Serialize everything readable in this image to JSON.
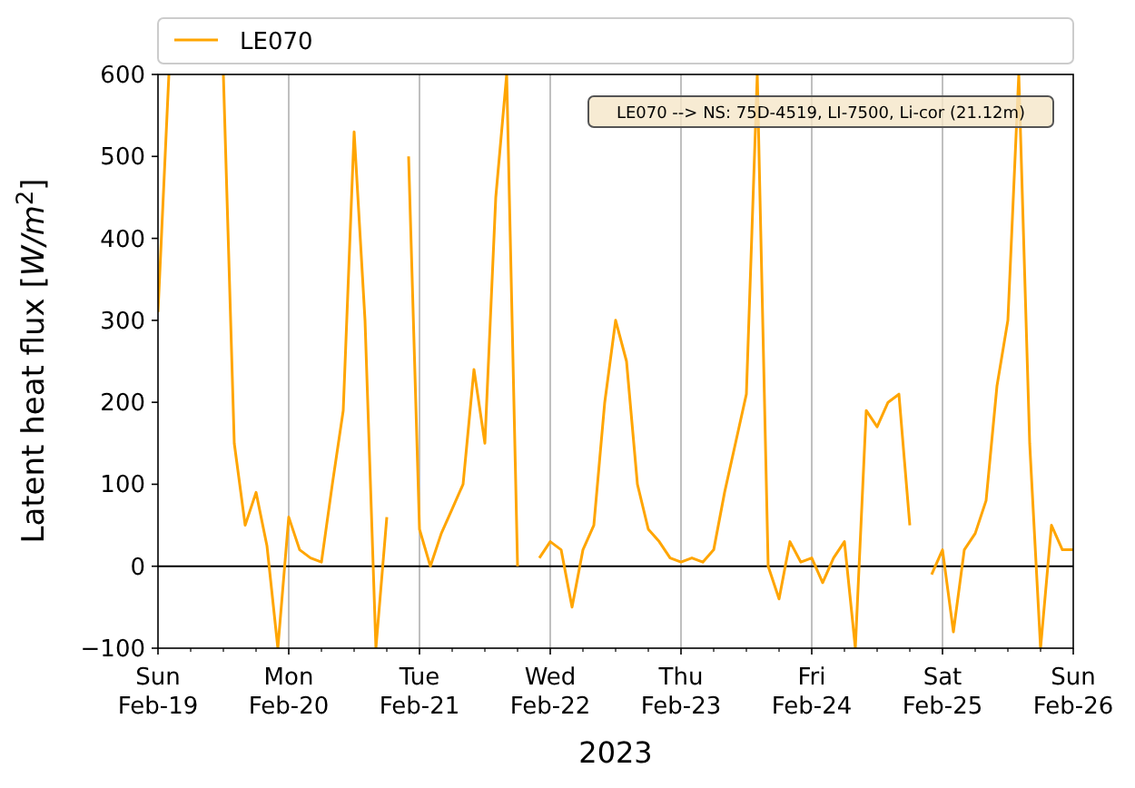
{
  "chart_data": {
    "type": "line",
    "xlabel": "2023",
    "ylabel": "Latent heat flux [*W/m*$^{2}$]",
    "categories": [
      "Sun\nFeb-19",
      null,
      null,
      null,
      null,
      null,
      null,
      null,
      null,
      null,
      null,
      null,
      "Mon\nFeb-20",
      null,
      null,
      null,
      null,
      null,
      null,
      null,
      null,
      null,
      null,
      null,
      "Tue\nFeb-21",
      null,
      null,
      null,
      null,
      null,
      null,
      null,
      null,
      null,
      null,
      null,
      "Wed\nFeb-22",
      null,
      null,
      null,
      null,
      null,
      null,
      null,
      null,
      null,
      null,
      null,
      "Thu\nFeb-23",
      null,
      null,
      null,
      null,
      null,
      null,
      null,
      null,
      null,
      null,
      null,
      "Fri\nFeb-24",
      null,
      null,
      null,
      null,
      null,
      null,
      null,
      null,
      null,
      null,
      null,
      "Sat\nFeb-25",
      null,
      null,
      null,
      null,
      null,
      null,
      null,
      null,
      null,
      null,
      null,
      "Sun\nFeb-26"
    ],
    "series": [
      {
        "name": "LE070",
        "color": "#ffa500",
        "values": [
          310,
          600,
          null,
          null,
          null,
          null,
          600,
          150,
          50,
          90,
          25,
          -100,
          60,
          20,
          10,
          5,
          100,
          190,
          530,
          300,
          -100,
          60,
          null,
          500,
          45,
          0,
          40,
          70,
          100,
          240,
          150,
          450,
          600,
          0,
          null,
          10,
          30,
          20,
          -50,
          20,
          50,
          200,
          300,
          250,
          100,
          45,
          30,
          10,
          5,
          10,
          5,
          20,
          90,
          150,
          210,
          600,
          0,
          -40,
          30,
          5,
          10,
          -20,
          10,
          30,
          -100,
          190,
          170,
          200,
          210,
          50,
          null,
          -10,
          20,
          -80,
          20,
          40,
          80,
          220,
          300,
          600,
          150,
          -100,
          50,
          20,
          20
        ]
      }
    ],
    "grid": true,
    "ylim": [
      -100,
      600
    ],
    "yticks": [
      {
        "value": -100,
        "label": "−100"
      },
      0,
      100,
      200,
      300,
      400,
      500,
      600
    ],
    "annotations": [
      "LE070 --> NS: 75D-4519, LI-7500, Li-cor (21.12m)"
    ]
  }
}
